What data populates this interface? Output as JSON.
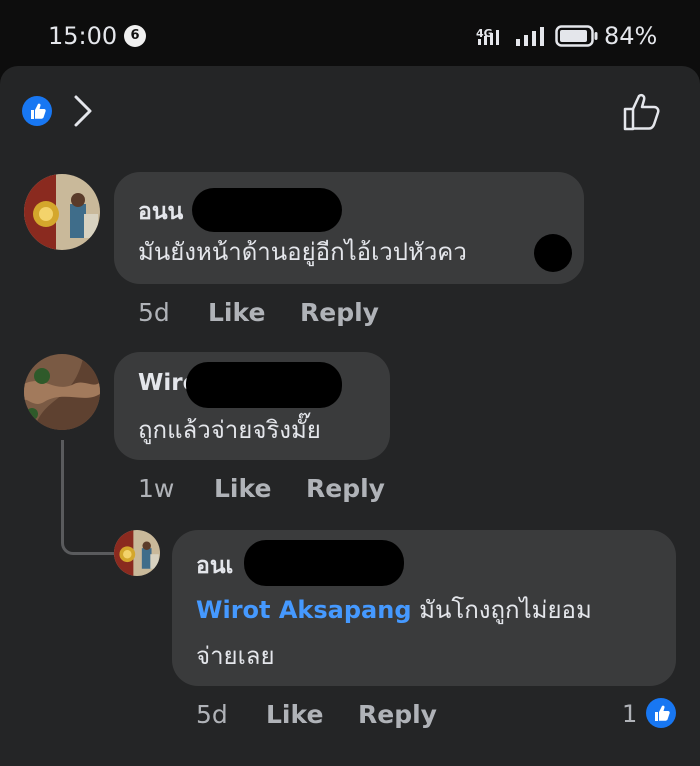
{
  "status": {
    "time": "15:00",
    "notification_count": "6",
    "network": "4G",
    "battery": "84%"
  },
  "comments": [
    {
      "author": "อนน",
      "text": "มันยังหน้าด้านอยู่อีกไอ้เวปหัวคว",
      "time": "5d",
      "like_label": "Like",
      "reply_label": "Reply"
    },
    {
      "author": "Wiro",
      "text": "ถูกแล้วจ่ายจริงมั๊ย",
      "time": "1w",
      "like_label": "Like",
      "reply_label": "Reply"
    },
    {
      "author": "อนเ",
      "mention": "Wirot Aksapang",
      "text_line1": " มันโกงถูกไม่ยอม",
      "text_line2": "จ่ายเลย",
      "time": "5d",
      "like_label": "Like",
      "reply_label": "Reply",
      "reaction_count": "1"
    }
  ],
  "colors": {
    "background": "#242526",
    "bubble": "#3a3b3c",
    "accent": "#1877f2",
    "mention": "#4599ff"
  }
}
